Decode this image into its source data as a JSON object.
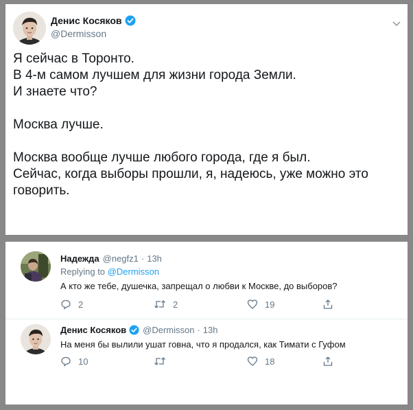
{
  "main_tweet": {
    "author_name": "Денис Косяков",
    "author_handle": "@Dermisson",
    "lines": [
      "Я сейчас в Торонто.",
      "В 4-м самом лучшем для жизни города Земли.",
      "И знаете что?",
      "",
      "Москва лучше.",
      "",
      "Москва вообще лучше любого города, где я был.",
      "Сейчас, когда выборы прошли, я, надеюсь, уже можно это",
      "говорить."
    ]
  },
  "replies": [
    {
      "author_name": "Надежда",
      "author_handle": "@negfz1",
      "separator": "·",
      "time": "13h",
      "replying_prefix": "Replying to",
      "replying_to": "@Dermisson",
      "text": "А кто же тебе, душечка, запрещал о любви к Москве, до выборов?",
      "reply_count": "2",
      "retweet_count": "2",
      "like_count": "19"
    },
    {
      "author_name": "Денис Косяков",
      "author_handle": "@Dermisson",
      "separator": "·",
      "time": "13h",
      "text": "На меня бы вылили ушат говна, что я продался, как Тимати с Гуфом",
      "reply_count": "10",
      "retweet_count": "",
      "like_count": "18"
    }
  ],
  "icons": {
    "verified": "verified-badge-icon",
    "chevron": "chevron-down-icon",
    "reply": "reply-icon",
    "retweet": "retweet-icon",
    "like": "heart-icon",
    "share": "share-icon"
  },
  "colors": {
    "verified": "#1da1f2",
    "link": "#1da1f2",
    "muted": "#657786",
    "background": "#888888"
  }
}
